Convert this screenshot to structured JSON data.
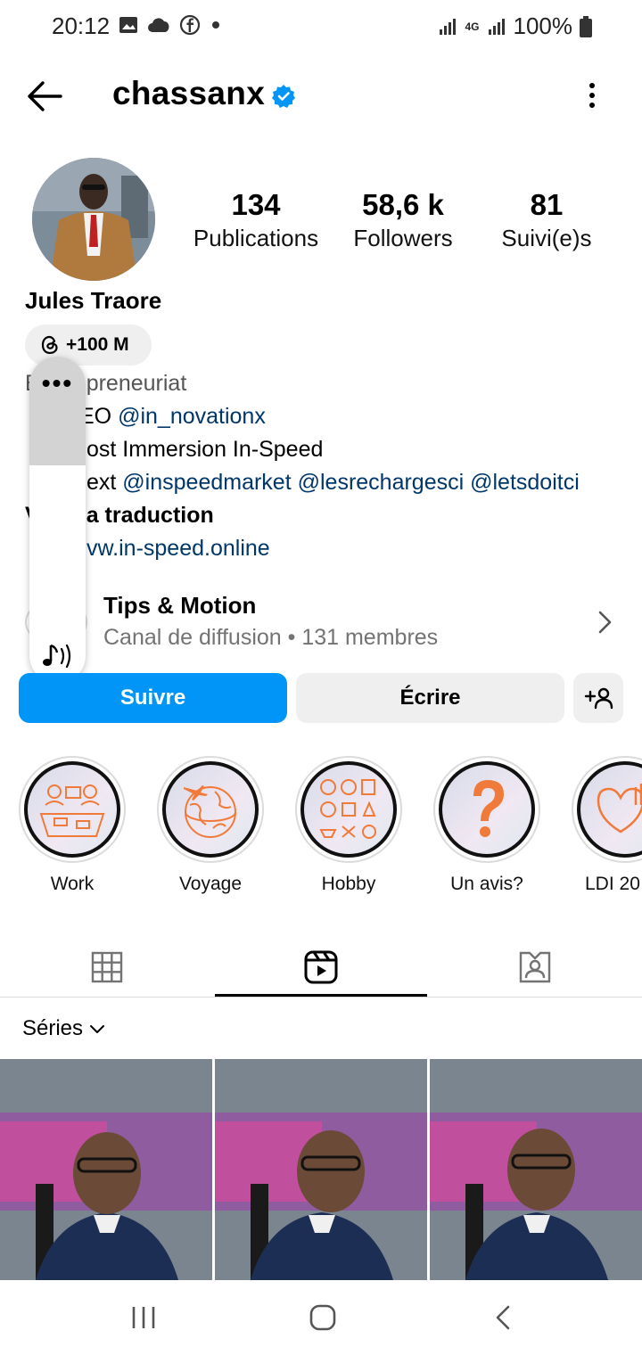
{
  "status_bar": {
    "time": "20:12",
    "network": "4G",
    "battery": "100%",
    "left_icons": [
      "gallery-icon",
      "cloud-icon",
      "facebook-icon",
      "dot-icon"
    ],
    "right_icons": [
      "signal-icon",
      "network-icon",
      "signal-icon",
      "battery-icon"
    ]
  },
  "header": {
    "username": "chassanx",
    "verified": true,
    "accent_verified": "#0095f6"
  },
  "profile": {
    "stats": [
      {
        "value": "134",
        "label": "Publications"
      },
      {
        "value": "58,6 k",
        "label": "Followers"
      },
      {
        "value": "81",
        "label": "Suivi(e)s"
      }
    ],
    "full_name": "Jules Traore",
    "threads_badge": "+100 M",
    "bio": {
      "line1": "preneuriat",
      "line1_prefix": "E",
      "line2_text": "EO ",
      "line2_link": "@in_novationx",
      "line3_text": "ost Immersion In-Speed",
      "line4_text": "ext ",
      "line4_links": [
        "@inspeedmarket",
        "@lesrechargesci",
        "@letsdoitci"
      ],
      "line5": "a traduction",
      "line5_prefix": "V",
      "line6_link": "vw.in-speed.online"
    }
  },
  "overlay": {
    "more_label": "•••"
  },
  "channel": {
    "title": "Tips & Motion",
    "subtitle": "Canal de diffusion • 131 membres"
  },
  "actions": {
    "follow": "Suivre",
    "message": "Écrire"
  },
  "highlights": [
    {
      "label": "Work",
      "icon": "work-desk-icon"
    },
    {
      "label": "Voyage",
      "icon": "globe-plane-icon"
    },
    {
      "label": "Hobby",
      "icon": "hobby-items-icon"
    },
    {
      "label": "Un avis?",
      "icon": "question-mark-icon"
    },
    {
      "label": "LDI 20",
      "icon": "heart-hand-icon"
    }
  ],
  "tabs": [
    {
      "name": "grid",
      "icon": "grid-icon"
    },
    {
      "name": "reels",
      "icon": "reels-icon",
      "selected": true
    },
    {
      "name": "tagged",
      "icon": "tagged-icon"
    }
  ],
  "series_filter": "Séries",
  "colors": {
    "link": "#00376b",
    "follow_button": "#0095f6",
    "secondary_button": "#efefef",
    "highlight_accent": "#f07a3a"
  }
}
